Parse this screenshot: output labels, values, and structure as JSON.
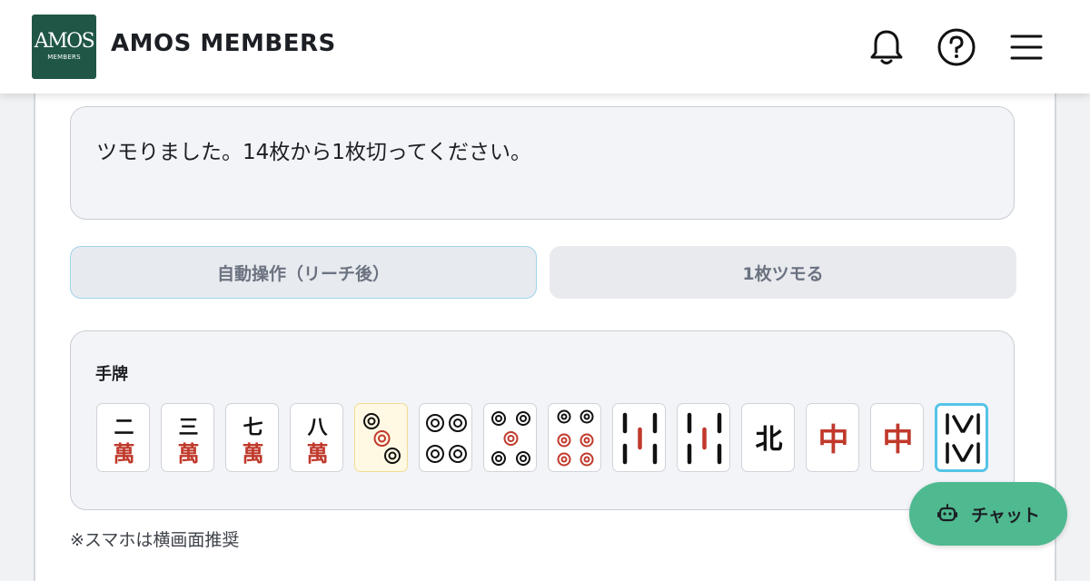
{
  "header": {
    "logo_text": "AMOS",
    "logo_subtext": "MEMBERS",
    "brand": "AMOS MEMBERS",
    "icons": [
      "bell-icon",
      "help-icon",
      "menu-icon"
    ]
  },
  "message": "ツモりました。14枚から1枚切ってください。",
  "buttons": {
    "auto": "自動操作（リーチ後）",
    "draw": "1枚ツモる"
  },
  "hand": {
    "label": "手牌",
    "tiles": [
      {
        "name": "二萬",
        "top": "二",
        "bottom": "萬"
      },
      {
        "name": "三萬",
        "top": "三",
        "bottom": "萬"
      },
      {
        "name": "七萬",
        "top": "七",
        "bottom": "萬"
      },
      {
        "name": "八萬",
        "top": "八",
        "bottom": "萬"
      },
      {
        "name": "三筒"
      },
      {
        "name": "四筒"
      },
      {
        "name": "五筒"
      },
      {
        "name": "六筒"
      },
      {
        "name": "五索"
      },
      {
        "name": "五索"
      },
      {
        "name": "北",
        "top": "北"
      },
      {
        "name": "中",
        "top": "中"
      },
      {
        "name": "中",
        "top": "中"
      },
      {
        "name": "八索"
      }
    ]
  },
  "note": "※スマホは横画面推奨",
  "chat": {
    "label": "チャット",
    "icon": "robot-icon"
  },
  "colors": {
    "logo_bg": "#1f5646",
    "chat_bg": "#4fb990",
    "tile_red": "#c0392b",
    "selected_border": "#55c4e6"
  }
}
